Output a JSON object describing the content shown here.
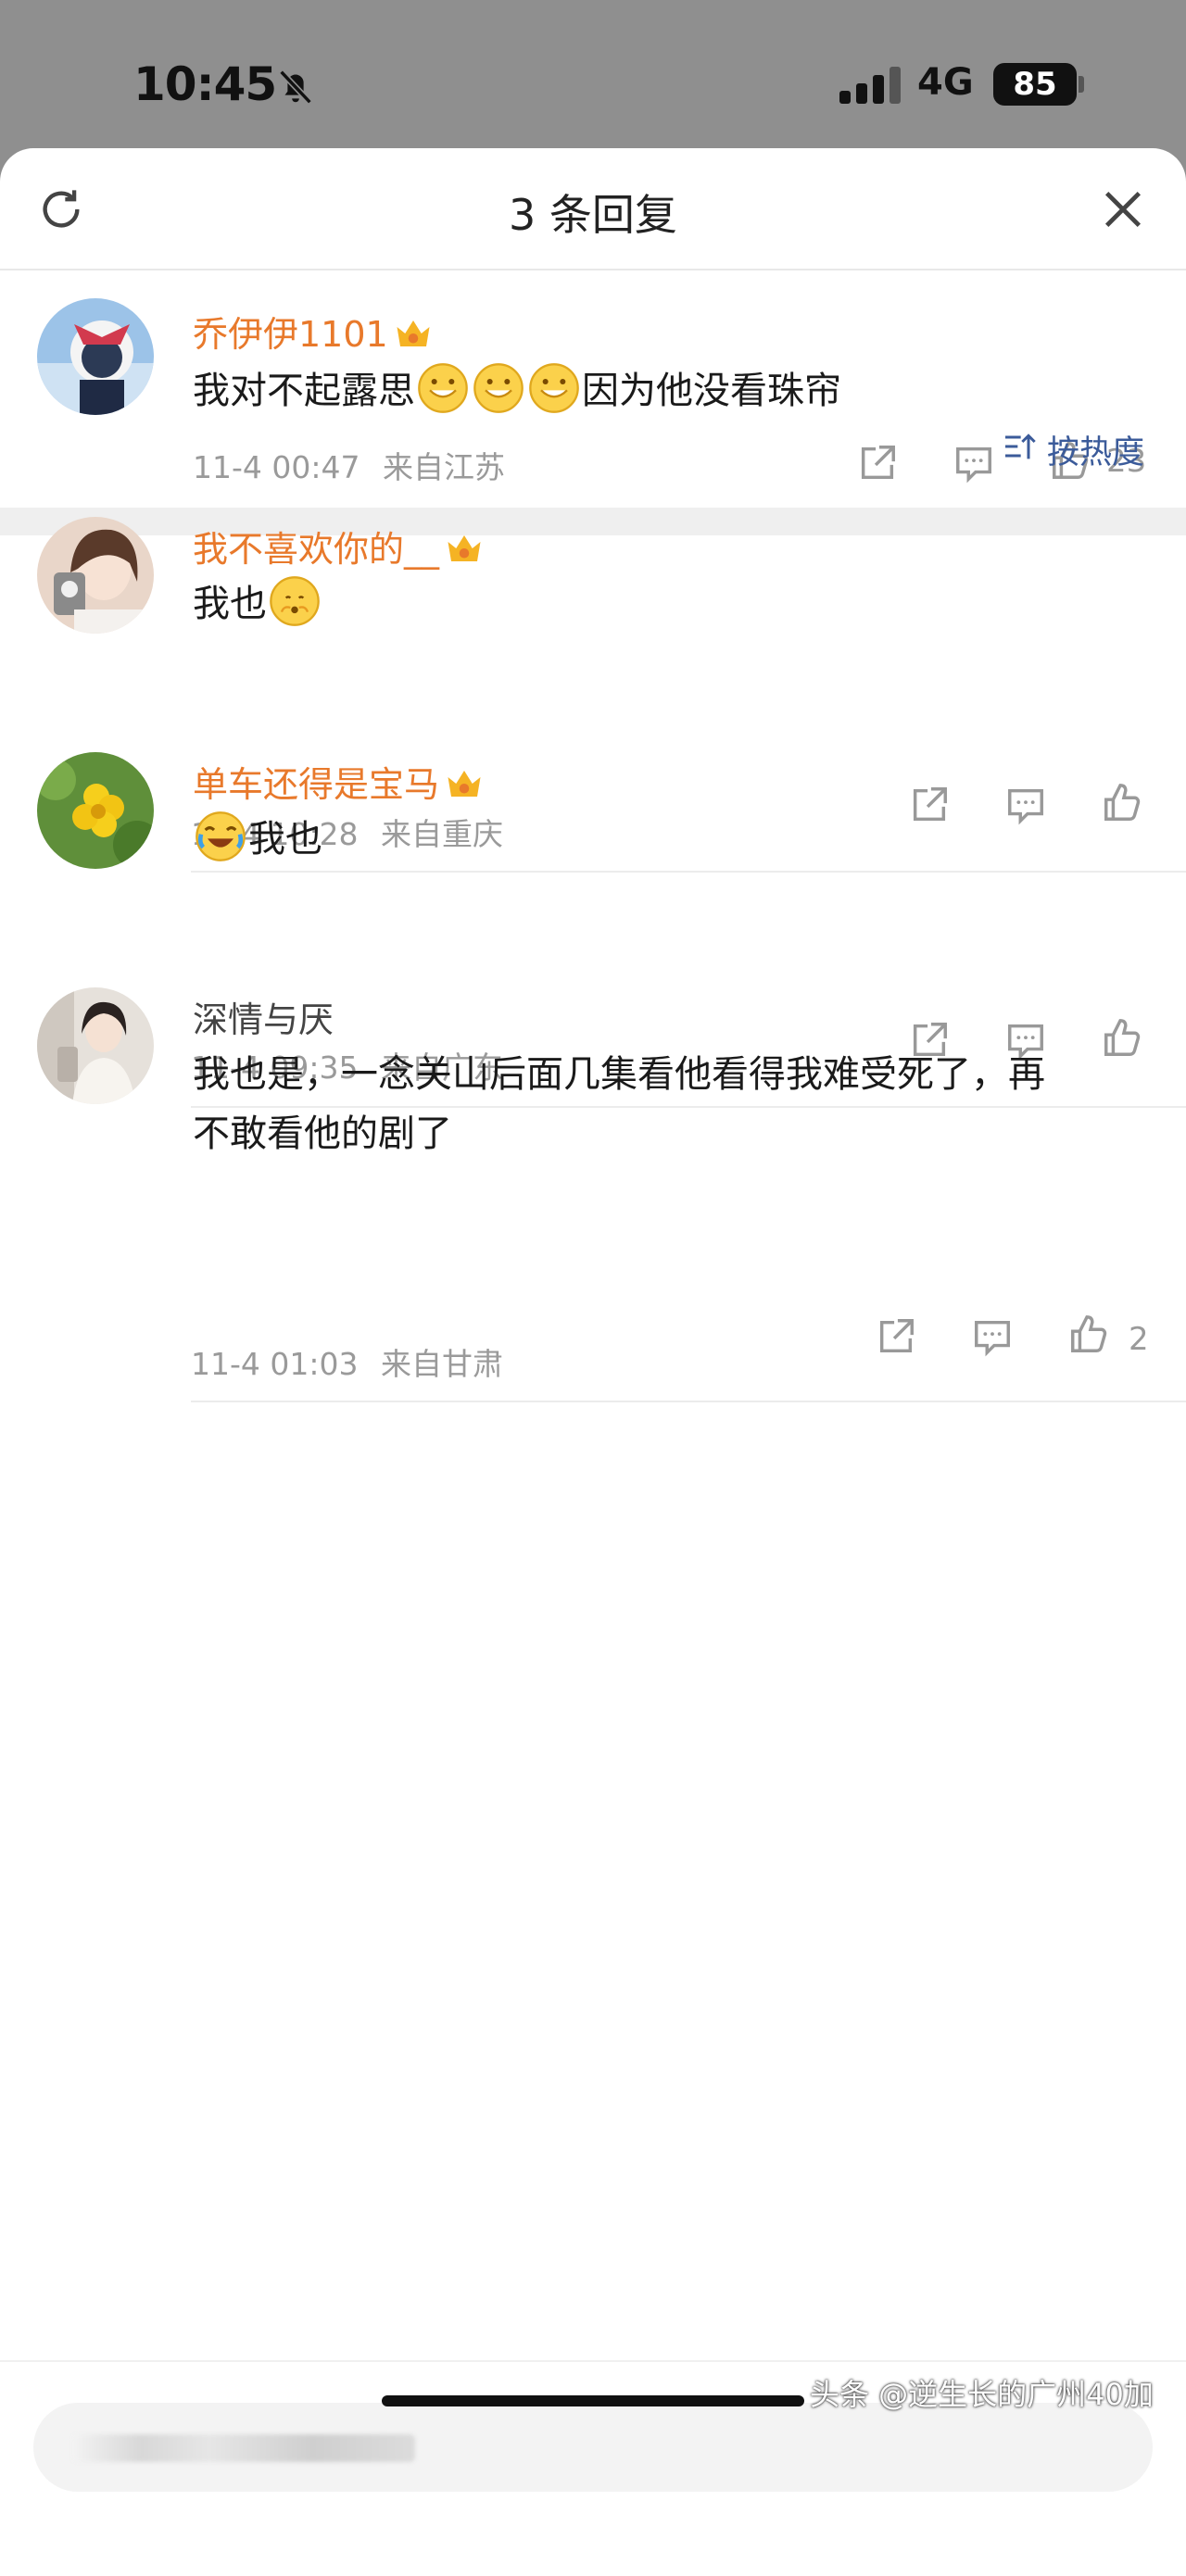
{
  "status": {
    "time": "10:45",
    "network": "4G",
    "battery": "85"
  },
  "sheet": {
    "title": "3 条回复"
  },
  "main_comment": {
    "user": "乔伊伊1101",
    "text_before": "我对不起露思",
    "text_after": "因为他没看珠帘",
    "date": "11-4 00:47",
    "location": "来自江苏",
    "likes": "23"
  },
  "sort_label": "按热度",
  "replies": [
    {
      "user": "我不喜欢你的__",
      "text": "我也",
      "date": "11-4 10:28",
      "location": "来自重庆",
      "likes": ""
    },
    {
      "user": "单车还得是宝马",
      "text": "我也",
      "date": "11-4 09:35",
      "location": "来自广东",
      "likes": ""
    },
    {
      "user": "深情与厌",
      "text_line1": "我也是，一念关山后面几集看他看得我难受死了，再",
      "text_line2": "不敢看他的剧了",
      "date": "11-4 01:03",
      "location": "来自甘肃",
      "likes": "2"
    }
  ],
  "watermark": "头条 @逆生长的广州40加",
  "colors": {
    "username": "#e8792b",
    "sort": "#3b5b9a",
    "meta": "#9a9a9a"
  },
  "icons": [
    "bell-slash-icon",
    "signal-icon",
    "refresh-icon",
    "close-icon",
    "share-icon",
    "comment-icon",
    "like-icon",
    "crown-icon",
    "sort-icon"
  ]
}
